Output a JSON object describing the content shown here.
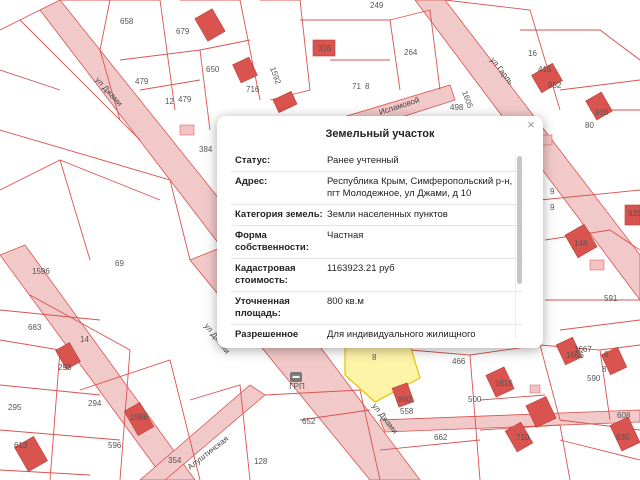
{
  "parcel_popup": {
    "title": "Земельный участок",
    "close_symbol": "×",
    "rows": [
      {
        "label": "Статус:",
        "value": "Ранее учтенный"
      },
      {
        "label": "Адрес:",
        "value": "Республика Крым, Симферопольский р-н, пгт Молодежное, ул Джами, д 10"
      },
      {
        "label": "Категория земель:",
        "value": "Земли населенных пунктов"
      },
      {
        "label": "Форма собственности:",
        "value": "Частная"
      },
      {
        "label": "Кадастровая стоимость:",
        "value": "1163923.21 руб"
      },
      {
        "label": "Уточненная площадь:",
        "value": "800 кв.м"
      },
      {
        "label": "Разрешенное использование:",
        "value": "Для индивидуального жилищного строительства"
      }
    ]
  },
  "map": {
    "colors": {
      "parcel_border": "#d9534f",
      "road_fill": "#f2c9c9",
      "building_fill": "#d9534f",
      "building_inner": "#f3c3c3",
      "selected_parcel_fill": "#fff3a8",
      "selected_parcel_border": "#e6c200"
    },
    "street_labels": [
      "ул Джами",
      "ул Джами",
      "ул Джами",
      "Исламовой",
      "ул Гарль",
      "Алуштинская"
    ],
    "parcel_numbers": [
      "658",
      "679",
      "479",
      "12",
      "479",
      "650",
      "1592",
      "716",
      "316",
      "264",
      "71",
      "8",
      "415",
      "16",
      "498",
      "1605",
      "80",
      "384",
      "69",
      "1596",
      "683",
      "293",
      "14",
      "295",
      "294",
      "613",
      "596",
      "354",
      "128",
      "652",
      "466",
      "860",
      "558",
      "500",
      "662",
      "710",
      "590",
      "608",
      "591",
      "148",
      "9",
      "1666",
      "6",
      "8",
      "916",
      "952",
      "1616",
      "928",
      "835",
      "1586",
      "1667",
      "249",
      "8",
      "9"
    ],
    "marker": {
      "icon": "grp-icon",
      "label": "ГРП"
    }
  }
}
